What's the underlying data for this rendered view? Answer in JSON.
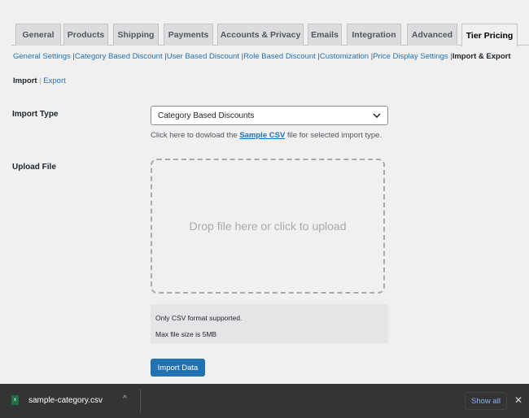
{
  "tabs": [
    {
      "label": "General"
    },
    {
      "label": "Products"
    },
    {
      "label": "Shipping"
    },
    {
      "label": "Payments"
    },
    {
      "label": "Accounts & Privacy"
    },
    {
      "label": "Emails"
    },
    {
      "label": "Integration"
    },
    {
      "label": "Advanced"
    },
    {
      "label": "Tier Pricing",
      "active": true
    }
  ],
  "subnav": [
    "General Settings",
    "Category Based Discount",
    "User Based Discount",
    "Role Based Discount",
    "Customization",
    "Price Display Settings",
    "Import & Export"
  ],
  "ie": {
    "import": "Import",
    "sep": "|",
    "export": "Export"
  },
  "form": {
    "import_type_label": "Import Type",
    "import_type_value": "Category Based Discounts",
    "hint_pre": "Click here to dowload the ",
    "hint_link": "Sample CSV",
    "hint_post": " file for selected import type.",
    "upload_label": "Upload File",
    "drop_text": "Drop file here or click to upload",
    "note1": "Only CSV format supported.",
    "note2": "Max file size is 5MB",
    "button": "Import Data"
  },
  "download_bar": {
    "filename": "sample-category.csv",
    "show_all": "Show all",
    "close": "✕",
    "chevron": "^",
    "file_icon": "excel-file-icon"
  }
}
